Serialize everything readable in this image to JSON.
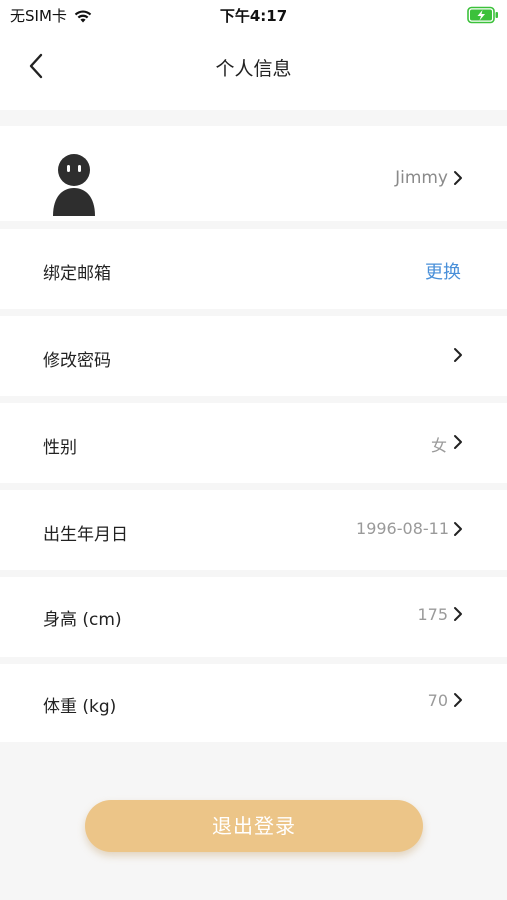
{
  "status_bar": {
    "carrier": "无SIM卡",
    "time": "下午4:17",
    "icons": [
      "wifi-icon",
      "battery-charging-icon"
    ],
    "battery_color": "#3cc13b"
  },
  "nav": {
    "title": "个人信息",
    "back_icon": "chevron-left-icon"
  },
  "profile": {
    "avatar_icon": "avatar-placeholder-icon",
    "name": "Jimmy"
  },
  "rows": [
    {
      "label": "绑定邮箱",
      "value": "更换",
      "chevron": false
    },
    {
      "label": "修改密码",
      "value": "",
      "chevron": true
    },
    {
      "label": "性别",
      "value": "女",
      "chevron": true
    },
    {
      "label": "出生年月日",
      "value": "1996-08-11",
      "chevron": true
    },
    {
      "label": "身高 (cm)",
      "value": "175",
      "chevron": true
    },
    {
      "label": "体重 (kg)",
      "value": "70",
      "chevron": true
    }
  ],
  "logout": {
    "label": "退出登录"
  },
  "colors": {
    "accent_link": "#4a90d9",
    "logout_button": "#ecc588",
    "background": "#f6f6f6"
  }
}
